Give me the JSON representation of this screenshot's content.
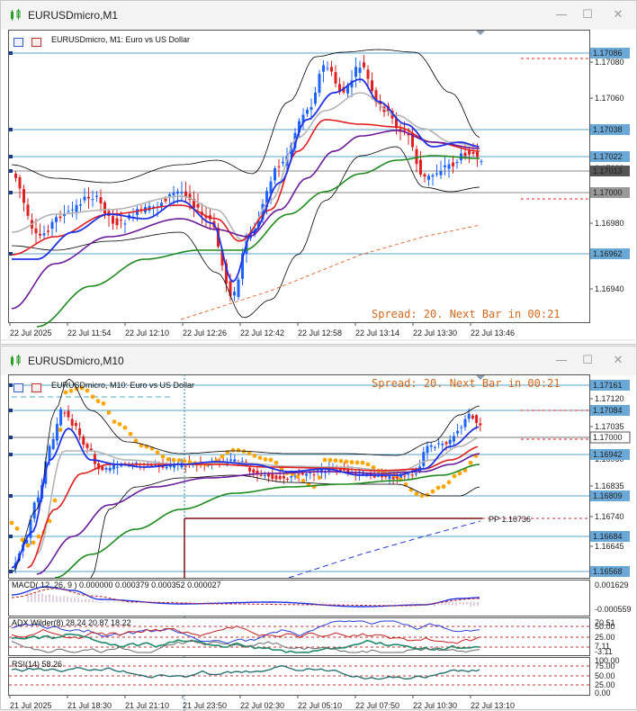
{
  "window1": {
    "title": "EURUSDmicro,M1",
    "chart_title": "EURUSDmicro, M1:  Euro vs US Dollar",
    "spread_text": "Spread: 20. Next Bar in 00:21",
    "price_labels": [
      "1.17086",
      "1.17038",
      "1.17022",
      "1.17013",
      "1.17000",
      "1.16962"
    ],
    "y_ticks": [
      "1.17080",
      "1.17060",
      "1.17020",
      "1.16980",
      "1.16940"
    ],
    "x_ticks": [
      "22 Jul 2025",
      "22 Jul 11:54",
      "22 Jul 12:10",
      "22 Jul 12:26",
      "22 Jul 12:42",
      "22 Jul 12:58",
      "22 Jul 13:14",
      "22 Jul 13:30",
      "22 Jul 13:46"
    ]
  },
  "window2": {
    "title": "EURUSDmicro,M10",
    "chart_title": "EURUSDmicro, M10:  Euro vs US Dollar",
    "spread_text": "Spread: 20. Next Bar in 00:21",
    "price_labels": [
      "1.17161",
      "1.17084",
      "1.17000",
      "1.16942",
      "1.16809",
      "1.16684",
      "1.16568"
    ],
    "y_ticks": [
      "1.17120",
      "1.17035",
      "1.16950",
      "1.16835",
      "1.16740",
      "1.16645"
    ],
    "pp_label": "PP 1.16736",
    "macd_label": "MACD( 12, 26, 9 ) 0.000000 0.000379 0.000352 0.000027",
    "macd_ticks": [
      "0.001629",
      "-0.000559"
    ],
    "adx_label": "ADX Wilder(8) 28.24 20.87 18.22",
    "adx_ticks": [
      "70.51",
      "50.00",
      "25.00",
      "7.11",
      "-3.11"
    ],
    "rsi_label": "RSI(14) 58.26",
    "rsi_ticks": [
      "100.00",
      "75.00",
      "50.00",
      "25.00",
      "0.00"
    ],
    "x_ticks": [
      "21 Jul 2025",
      "21 Jul 18:30",
      "21 Jul 21:10",
      "21 Jul 23:50",
      "22 Jul 02:30",
      "22 Jul 05:10",
      "22 Jul 07:50",
      "22 Jul 10:30",
      "22 Jul 13:10"
    ]
  },
  "window_buttons": {
    "minimize": "—",
    "maximize": "☐",
    "close": "✕"
  },
  "colors": {
    "bull": "#1e64ff",
    "bear": "#e02020",
    "ma_blue": "#1e32e6",
    "ma_red": "#e01e1e",
    "ma_purple": "#6a1b9a",
    "ma_green": "#1e8a1e",
    "ma_gray": "#b4b4b4",
    "band": "#000000",
    "spread": "#d2691e",
    "sar": "#ffa500"
  }
}
